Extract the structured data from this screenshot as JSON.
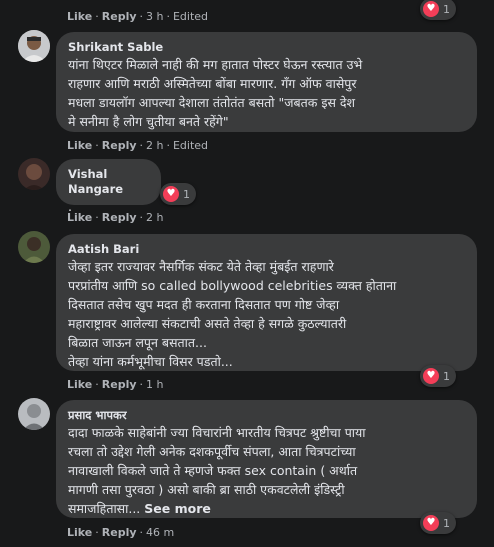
{
  "colors": {
    "background": "#18191a",
    "bubble": "#3a3b3c",
    "heart": "#f33e58",
    "text": "#e4e6eb",
    "muted": "#b0b3b8"
  },
  "top_comment": {
    "like": "Like",
    "reply": "Reply",
    "time": "3 h",
    "edited": "Edited",
    "reaction_icon": "heart-icon",
    "reaction_count": "1"
  },
  "comments": [
    {
      "author": "Shrikant Sable",
      "lines": [
        "यांना थिएटर मिळाले नाही की मग हातात पोस्टर घेऊन रस्त्यात उभे",
        "राहणार आणि मराठी अस्मितेच्या बोंबा मारणार. गँग ऑफ वासेपुर",
        "मधला डायलॉग आपल्या देशाला तंतोतंत बसतो \"जबतक इस देश",
        "मे सनीमा है लोग चुतीया बनते रहेंगे\""
      ],
      "like": "Like",
      "reply": "Reply",
      "time": "2 h",
      "edited": "Edited"
    },
    {
      "author": "Vishal Nangare",
      "lines": [
        "."
      ],
      "like": "Like",
      "reply": "Reply",
      "time": "2 h",
      "reaction_icon": "heart-icon",
      "reaction_count": "1"
    },
    {
      "author": "Aatish Bari",
      "lines": [
        "जेव्हा इतर राज्यावर नैसर्गिक संकट येते तेव्हा मुंबईत राहणारे",
        "परप्रांतीय आणि so called bollywood celebrities व्यक्त होताना",
        "दिसतात तसेच खुप मदत ही करताना दिसतात पण गोष्ट जेव्हा",
        "महाराष्ट्रावर आलेल्या संकटाची असते तेव्हा हे सगळे कुठल्यातरी",
        "बिळात जाऊन लपून बसतात...",
        "तेव्हा यांना कर्मभूमीचा विसर पडतो..."
      ],
      "like": "Like",
      "reply": "Reply",
      "time": "1 h",
      "reaction_icon": "heart-icon",
      "reaction_count": "1"
    },
    {
      "author": "प्रसाद भापकर",
      "lines": [
        "दादा फाळके साहेबांनी ज्या विचारांनी भारतीय चित्रपट श्रुष्टीचा पाया",
        "रचला तो उद्देश गेली अनेक दशकपूर्वीच संपला, आता चित्रपटांच्या",
        "नावाखाली विकले जाते ते म्हणजे फक्त sex contain ( अर्थात",
        "मागणी तसा पुरवठा ) असो बाकी ब्रा साठी एकवटलेली इंडिस्ट्री",
        "समाजहितासा..."
      ],
      "see_more": "See more",
      "like": "Like",
      "reply": "Reply",
      "time": "46 m",
      "reaction_icon": "heart-icon",
      "reaction_count": "1"
    }
  ]
}
